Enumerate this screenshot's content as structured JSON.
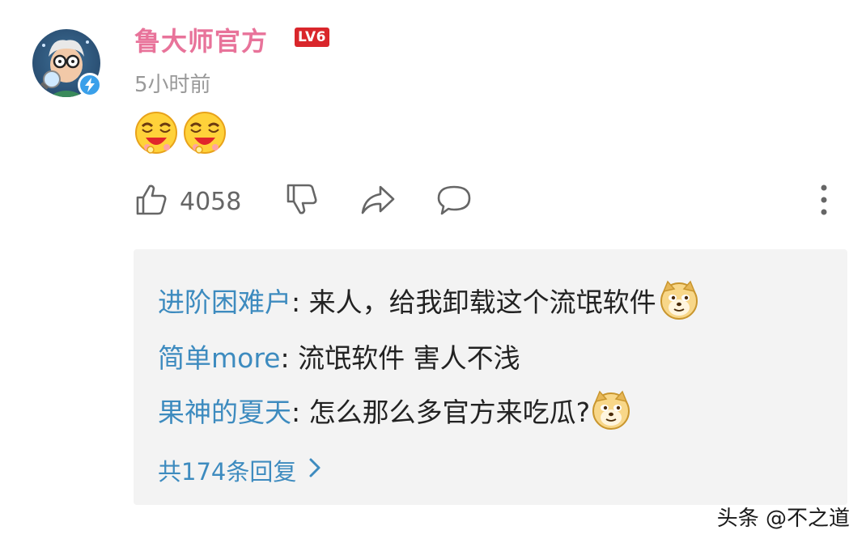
{
  "comment": {
    "username": "鲁大师官方",
    "level": "LV6",
    "time": "5小时前",
    "emoji_count": 2,
    "likes": "4058"
  },
  "icons": {
    "avatar": "cartoon-avatar",
    "verified": "lightning-badge-icon",
    "emoji": "laughing-face-emoji",
    "like": "thumbs-up-icon",
    "dislike": "thumbs-down-icon",
    "share": "share-arrow-icon",
    "comment": "speech-bubble-icon",
    "more": "vertical-dots-icon",
    "reply_emoji": "doge-emoji",
    "chevron": "chevron-right-icon"
  },
  "replies": [
    {
      "user": "进阶困难户",
      "text": ": 来人，给我卸载这个流氓软件",
      "emoji": true
    },
    {
      "user": "简单more",
      "text": ": 流氓软件 害人不浅",
      "emoji": false
    },
    {
      "user": "果神的夏天",
      "text": ": 怎么那么多官方来吃瓜?",
      "emoji": true
    }
  ],
  "more_replies": "共174条回复",
  "watermark": "头条 @不之道",
  "colors": {
    "username": "#e8739a",
    "level_badge": "#d9262b",
    "reply_user": "#3d8bbf",
    "reply_bg": "#f3f3f3",
    "verified": "#3aa0ea"
  }
}
